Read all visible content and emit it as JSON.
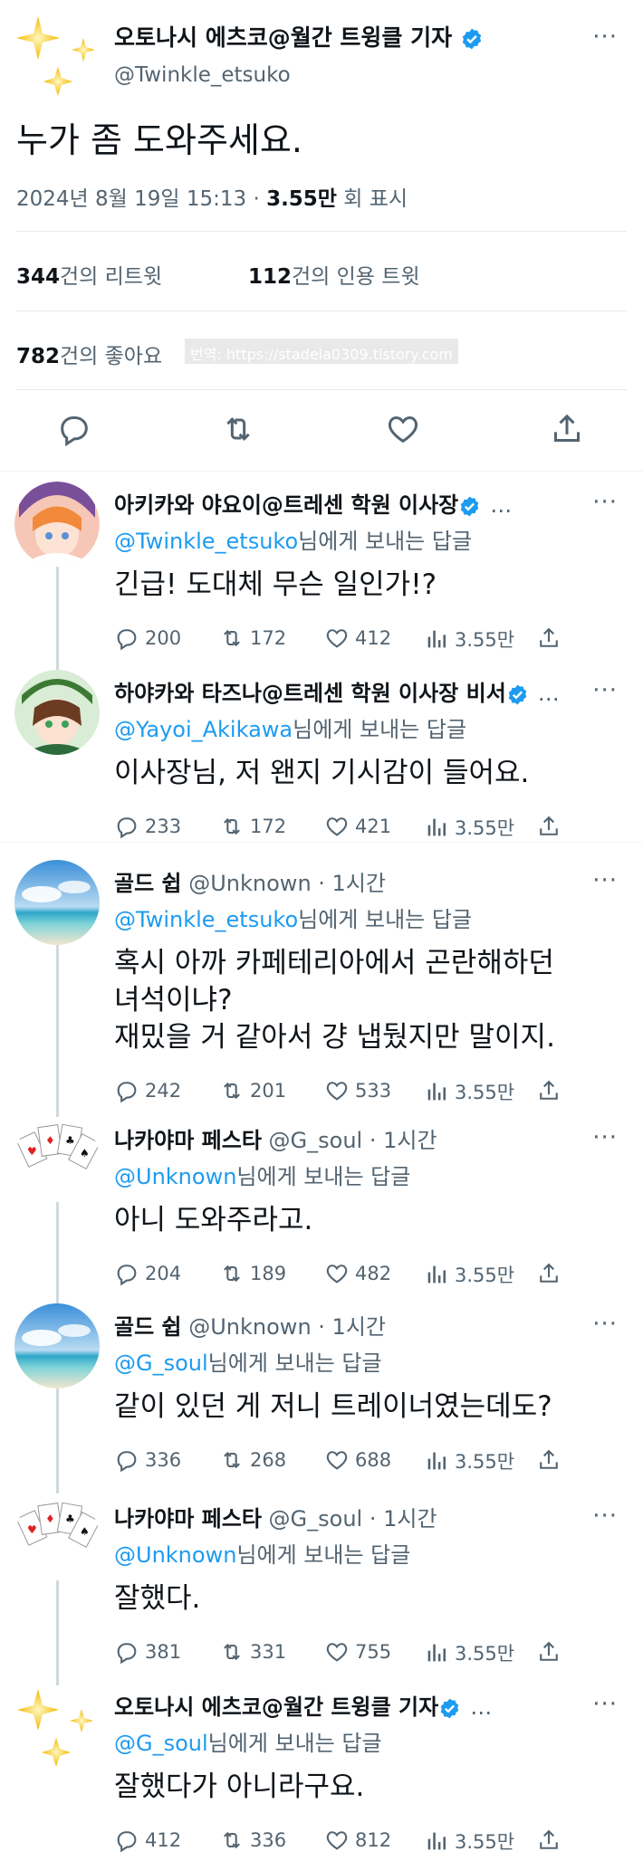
{
  "main_tweet": {
    "author_name": "오토나시 에츠코@월간 트윙클 기자",
    "handle": "@Twinkle_etsuko",
    "text": "누가 좀 도와주세요.",
    "time": "2024년 8월 19일 15:13 · ",
    "views_count": "3.55만",
    "views_suffix": " 회 표시",
    "retweets_count": "344",
    "retweets_label": "건의 리트윗",
    "quotes_count": "112",
    "quotes_label": "건의 인용 트윗",
    "likes_count": "782",
    "likes_label": "건의 좋아요",
    "watermark": "번역: https://stadela0309.tistory.com"
  },
  "replies": [
    {
      "name": "아키카와 야요이@트레센 학원 이사장",
      "handle": "",
      "time": "",
      "verified": true,
      "ellipsis": "…",
      "to_handle": "@Twinkle_etsuko",
      "to_suffix": "님에게 보내는 답글",
      "text": "긴급! 도대체 무슨 일인가!?",
      "replies": "200",
      "retweets": "172",
      "likes": "412",
      "views": "3.55만"
    },
    {
      "name": "하야카와 타즈나@트레센 학원 이사장 비서",
      "handle": "",
      "time": "",
      "verified": true,
      "ellipsis": "…",
      "to_handle": "@Yayoi_Akikawa",
      "to_suffix": "님에게 보내는 답글",
      "text": "이사장님, 저 왠지 기시감이 들어요.",
      "replies": "233",
      "retweets": "172",
      "likes": "421",
      "views": "3.55만"
    },
    {
      "name": "골드 쉽",
      "handle": " @Unknown",
      "time": " · 1시간",
      "verified": false,
      "ellipsis": "",
      "to_handle": "@Twinkle_etsuko",
      "to_suffix": "님에게 보내는 답글",
      "text": "혹시 아까 카페테리아에서 곤란해하던\n녀석이냐?\n재밌을 거 같아서 걍 냅뒀지만 말이지.",
      "replies": "242",
      "retweets": "201",
      "likes": "533",
      "views": "3.55만"
    },
    {
      "name": "나카야마 페스타",
      "handle": " @G_soul",
      "time": " · 1시간",
      "verified": false,
      "ellipsis": "",
      "to_handle": "@Unknown",
      "to_suffix": "님에게 보내는 답글",
      "text": "아니 도와주라고.",
      "replies": "204",
      "retweets": "189",
      "likes": "482",
      "views": "3.55만"
    },
    {
      "name": "골드 쉽",
      "handle": " @Unknown",
      "time": " · 1시간",
      "verified": false,
      "ellipsis": "",
      "to_handle": "@G_soul",
      "to_suffix": "님에게 보내는 답글",
      "text": "같이 있던 게 저니 트레이너였는데도?",
      "replies": "336",
      "retweets": "268",
      "likes": "688",
      "views": "3.55만"
    },
    {
      "name": "나카야마 페스타",
      "handle": " @G_soul",
      "time": " · 1시간",
      "verified": false,
      "ellipsis": "",
      "to_handle": "@Unknown",
      "to_suffix": "님에게 보내는 답글",
      "text": "잘했다.",
      "replies": "381",
      "retweets": "331",
      "likes": "755",
      "views": "3.55만"
    },
    {
      "name": "오토나시 에츠코@월간 트윙클 기자",
      "handle": "",
      "time": "",
      "verified": true,
      "ellipsis": "…",
      "to_handle": "@G_soul",
      "to_suffix": "님에게 보내는 답글",
      "text": "잘했다가 아니라구요.",
      "replies": "412",
      "retweets": "336",
      "likes": "812",
      "views": "3.55만"
    }
  ],
  "colors": {
    "accent": "#1d9bf0",
    "muted": "#536471",
    "text": "#0f1419"
  },
  "icons": {
    "reply": "reply-icon",
    "retweet": "retweet-icon",
    "like": "heart-icon",
    "views": "views-icon",
    "share": "share-icon",
    "more": "more-icon",
    "verified": "verified-icon"
  }
}
